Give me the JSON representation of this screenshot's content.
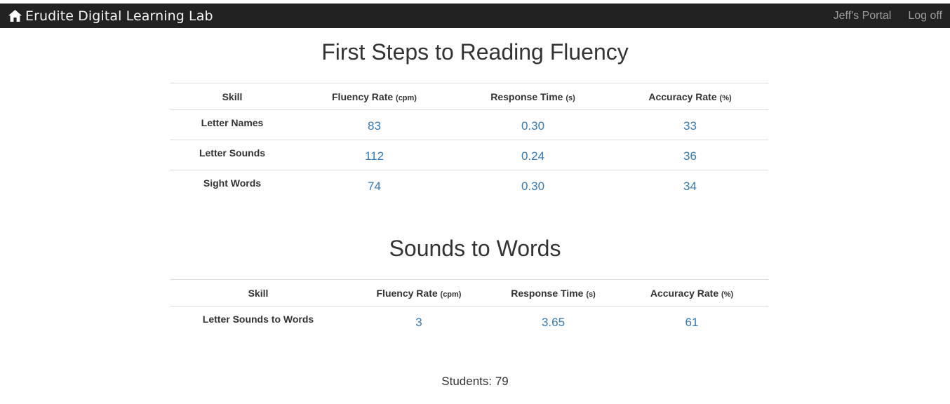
{
  "navbar": {
    "brand": "Erudite Digital Learning Lab",
    "brand_icon": "home-icon",
    "links": [
      "Jeff's Portal",
      "Log off"
    ]
  },
  "sections": [
    {
      "title": "First Steps to Reading Fluency",
      "headers": [
        {
          "label": "Skill",
          "unit": ""
        },
        {
          "label": "Fluency Rate",
          "unit": "(cpm)"
        },
        {
          "label": "Response Time",
          "unit": "(s)"
        },
        {
          "label": "Accuracy Rate",
          "unit": "(%)"
        }
      ],
      "rows": [
        [
          "Letter Names",
          "83",
          "0.30",
          "33"
        ],
        [
          "Letter Sounds",
          "112",
          "0.24",
          "36"
        ],
        [
          "Sight Words",
          "74",
          "0.30",
          "34"
        ]
      ]
    },
    {
      "title": "Sounds to Words",
      "headers": [
        {
          "label": "Skill",
          "unit": ""
        },
        {
          "label": "Fluency Rate",
          "unit": "(cpm)"
        },
        {
          "label": "Response Time",
          "unit": "(s)"
        },
        {
          "label": "Accuracy Rate",
          "unit": "(%)"
        }
      ],
      "rows": [
        [
          "Letter Sounds to Words",
          "3",
          "3.65",
          "61"
        ]
      ]
    }
  ],
  "footer": {
    "students": "Students: 79"
  },
  "colors": {
    "navbar_bg": "#222222",
    "link": "#337ab7",
    "nav_link": "#9d9d9d"
  }
}
